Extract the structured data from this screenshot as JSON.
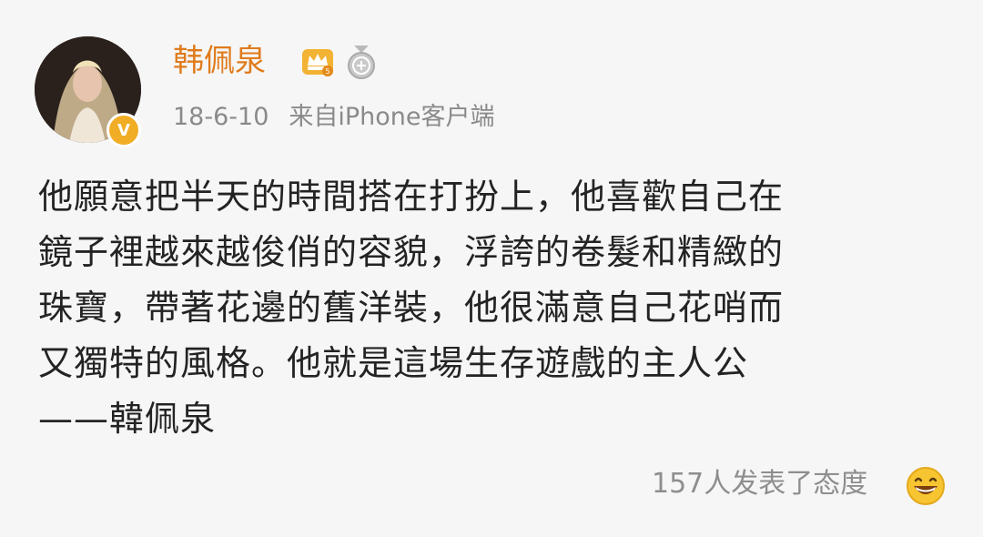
{
  "post": {
    "username": "韩佩泉",
    "date": "18-6-10",
    "source": "来自iPhone客户端",
    "body_lines": [
      "他願意把半天的時間搭在打扮上，他喜歡自己在",
      "鏡子裡越來越俊俏的容貌，浮誇的卷髮和精緻的",
      "珠寶，帶著花邊的舊洋裝，他很滿意自己花哨而",
      "又獨特的風格。他就是這場生存遊戲的主人公",
      "——韓佩泉"
    ],
    "reactions": "157人发表了态度",
    "verified_mark": "V"
  },
  "icons": {
    "avatar": "avatar",
    "verified": "verified-badge-icon",
    "vip": "crown-vip-icon",
    "medal": "medal-icon",
    "reaction": "grinning-emoji-icon"
  },
  "colors": {
    "username": "#e07b1c",
    "verified": "#f1ad25",
    "meta": "#8a8a8a",
    "body": "#232323",
    "background": "#f6f6f6"
  }
}
